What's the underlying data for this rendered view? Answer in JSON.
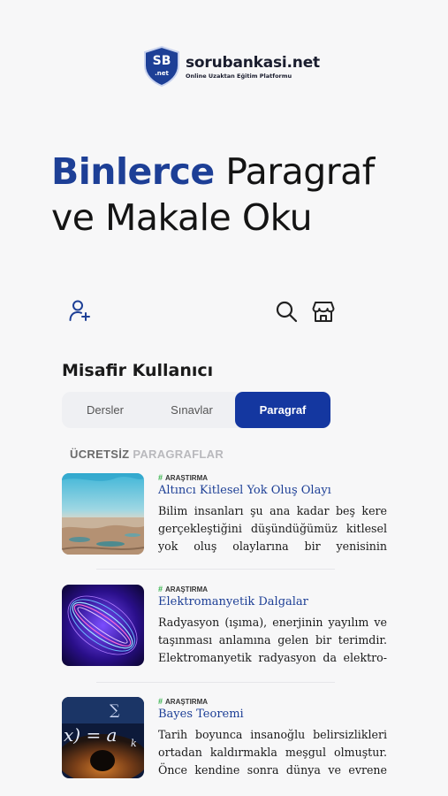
{
  "logo": {
    "badge_top": "SB",
    "badge_bottom": ".net",
    "name": "sorubankasi.net",
    "tagline": "Online Uzaktan Eğitim Platformu"
  },
  "hero": {
    "accent": "Binlerce",
    "rest_line1": " Paragraf",
    "line2": "ve Makale Oku"
  },
  "icons": {
    "add_user": "add-user-icon",
    "search": "search-icon",
    "shop": "shop-icon"
  },
  "user": {
    "name": "Misafir Kullanıcı"
  },
  "tabs": [
    {
      "label": "Dersler",
      "active": false
    },
    {
      "label": "Sınavlar",
      "active": false
    },
    {
      "label": "Paragraf",
      "active": true
    }
  ],
  "section": {
    "part1": "ÜCRETSİZ",
    "part2": " PARAGRAFLAR"
  },
  "articles": [
    {
      "category": "ARAŞTIRMA",
      "title": "Altıncı Kitlesel Yok Oluş Olayı",
      "text": "Bilim insanları şu ana kadar beş kere gerçekleştiğini düşündüğümüz kitlesel yok oluş olaylarına bir yenisinin"
    },
    {
      "category": "ARAŞTIRMA",
      "title": "Elektromanyetik Dalgalar",
      "text": "Radyasyon (ışıma), enerjinin yayılım ve taşınması anlamına gelen bir terimdir. Elektromanyetik radyasyon da elektro-"
    },
    {
      "category": "ARAŞTIRMA",
      "title": "Bayes Teoremi",
      "text": "Tarih boyunca insanoğlu belirsizlikleri ortadan kaldırmakla meşgul olmuştur. Önce kendine sonra dünya ve evrene"
    }
  ],
  "colors": {
    "primary": "#1437a0",
    "accent_text": "#1d3f96",
    "category_hash": "#34b34a"
  }
}
